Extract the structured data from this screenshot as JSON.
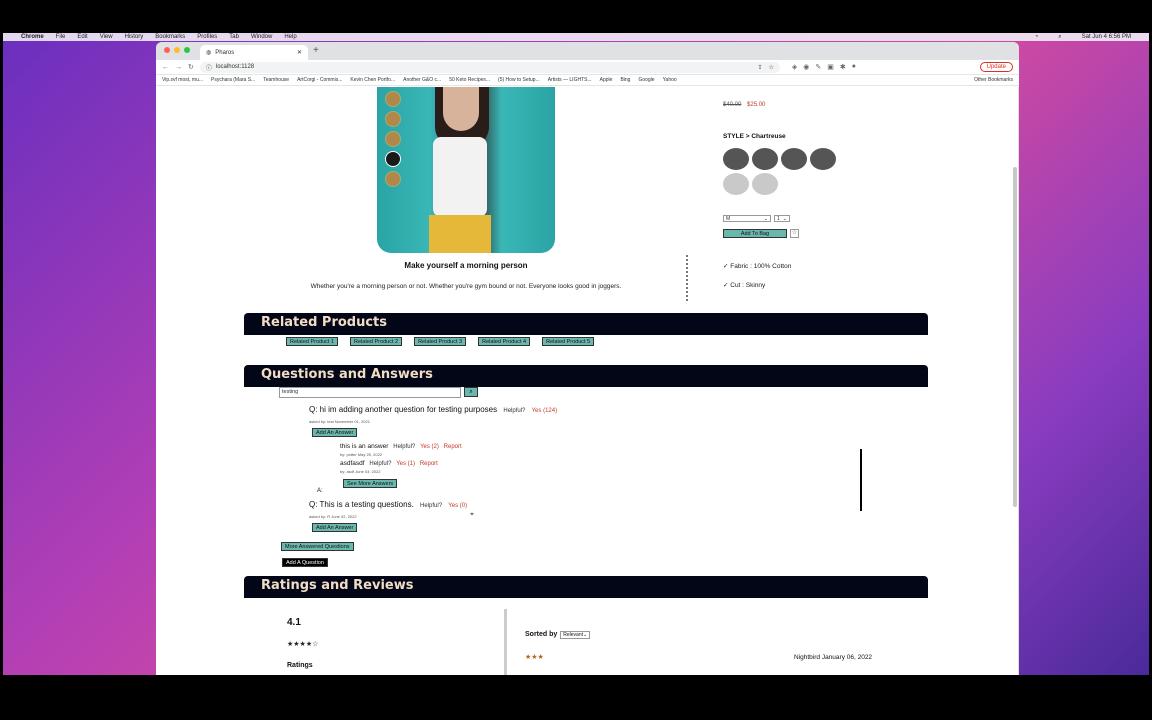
{
  "menubar": {
    "items": [
      "Chrome",
      "File",
      "Edit",
      "View",
      "History",
      "Bookmarks",
      "Profiles",
      "Tab",
      "Window",
      "Help"
    ],
    "clock": "Sat Jun 4  6:56 PM"
  },
  "browser": {
    "tab_title": "Pharos",
    "url": "localhost:1128",
    "update_label": "Update",
    "bookmarks": [
      "Vip.svf most, mu...",
      "Psychara (Mara S...",
      "Teamhouse",
      "ArtCorgi - Commis...",
      "Kevin Chen Portfo...",
      "Another G&O c...",
      "50 Keto Recipes...",
      "(5) How to Setup...",
      "Artists — LIGHTS...",
      "Apple",
      "Bing",
      "Google",
      "Yahoo"
    ],
    "other_bookmarks": "Other Bookmarks"
  },
  "product": {
    "title": "Make yourself a morning person",
    "description": "Whether you're a morning person or not. Whether you're gym bound or not. Everyone looks good in joggers.",
    "old_price": "$40.00",
    "sale_price": "$25.00",
    "style_label": "STYLE > Chartreuse",
    "size_value": "M",
    "qty_value": "1",
    "add_to_bag": "Add To Bag",
    "features": [
      "✓ Fabric : 100% Cotton",
      "✓ Cut : Skinny"
    ]
  },
  "related": {
    "heading": "Related Products",
    "items": [
      "Related Product 1",
      "Related Product 2",
      "Related Product 3",
      "Related Product 4",
      "Related Product 5"
    ]
  },
  "qa": {
    "heading": "Questions and Answers",
    "search_value": "testing",
    "questions": [
      {
        "text": "Q: hi im adding another question for testing purposes",
        "helpful": "Helpful?",
        "yes": "Yes (124)",
        "meta": "asked by: test  November 01, 2021",
        "add_answer": "Add An Answer",
        "answers_label": "A:",
        "answers": [
          {
            "text": "this is an answer",
            "helpful": "Helpful?",
            "yes": "Yes (2)",
            "report": "Report",
            "meta": "by: potter  May 25, 2022"
          },
          {
            "text": "asdfasdf",
            "helpful": "Helpful?",
            "yes": "Yes (1)",
            "report": "Report",
            "meta": "by: asdf  June 03, 2022"
          }
        ],
        "see_more": "See More Answers"
      },
      {
        "text": "Q: This is a testing questions.",
        "helpful": "Helpful?",
        "yes": "Yes (0)",
        "meta": "asked by: R  June 02, 2022",
        "add_answer": "Add An Answer"
      }
    ],
    "more_questions": "More Answered Questions",
    "add_question": "Add A Question"
  },
  "reviews": {
    "heading": "Ratings and Reviews",
    "average": "4.1",
    "average_stars": "★★★★☆",
    "ratings_label": "Ratings",
    "sorted_by": "Sorted by",
    "sort_value": "Relevant",
    "first_review_stars": "★★★",
    "first_review_author": "Nightbird January 06, 2022"
  },
  "colors": {
    "banner": "#020617",
    "banner_text": "#f1dcc6",
    "teal_button": "#6ab7ad",
    "accent_red": "#c0392b"
  }
}
